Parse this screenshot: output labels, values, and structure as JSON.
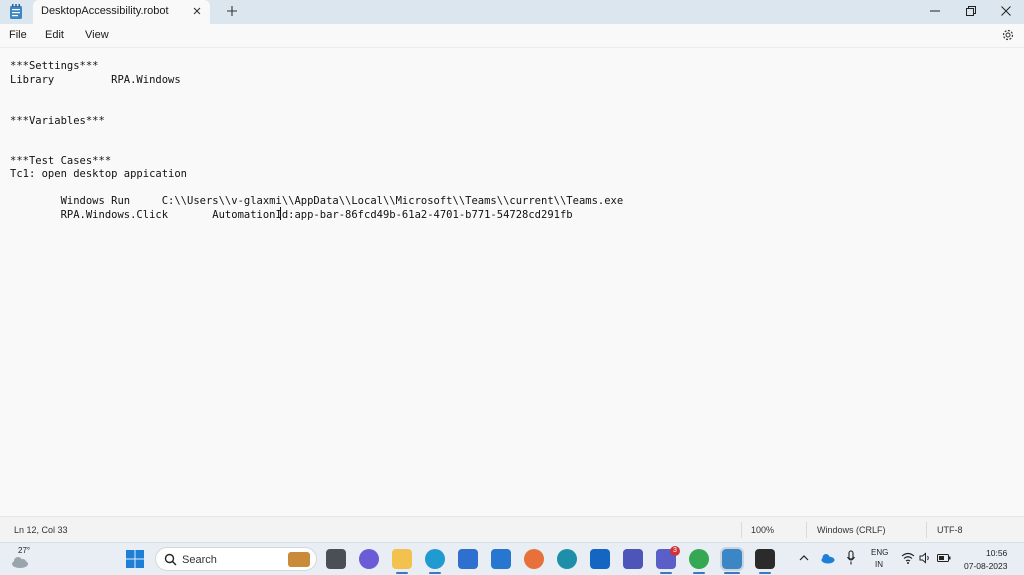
{
  "window": {
    "tab_title": "DesktopAccessibility.robot"
  },
  "menu": {
    "file": "File",
    "edit": "Edit",
    "view": "View"
  },
  "editor": {
    "lines": [
      "***Settings***",
      "Library         RPA.Windows",
      "***Variables***",
      "***Test Cases***",
      "Tc1: open desktop appication",
      "        Windows Run     C:\\\\Users\\\\v-glaxmi\\\\AppData\\\\Local\\\\Microsoft\\\\Teams\\\\current\\\\Teams.exe",
      "        RPA.Windows.Click       AutomationId:app-bar-86fcd49b-61a2-4701-b771-54728cd291fb"
    ]
  },
  "status": {
    "position": "Ln 12, Col 33",
    "zoom": "100%",
    "line_ending": "Windows (CRLF)",
    "encoding": "UTF-8"
  },
  "taskbar": {
    "weather": "27°",
    "search_placeholder": "Search",
    "teams_badge": "3",
    "language": "ENG",
    "region": "IN",
    "time": "10:56",
    "date": "07-08-2023"
  },
  "colors": {
    "accent": "#3b78c4",
    "editor_bg": "#f9f9f9",
    "titlebar_bg": "#dce6ee"
  }
}
